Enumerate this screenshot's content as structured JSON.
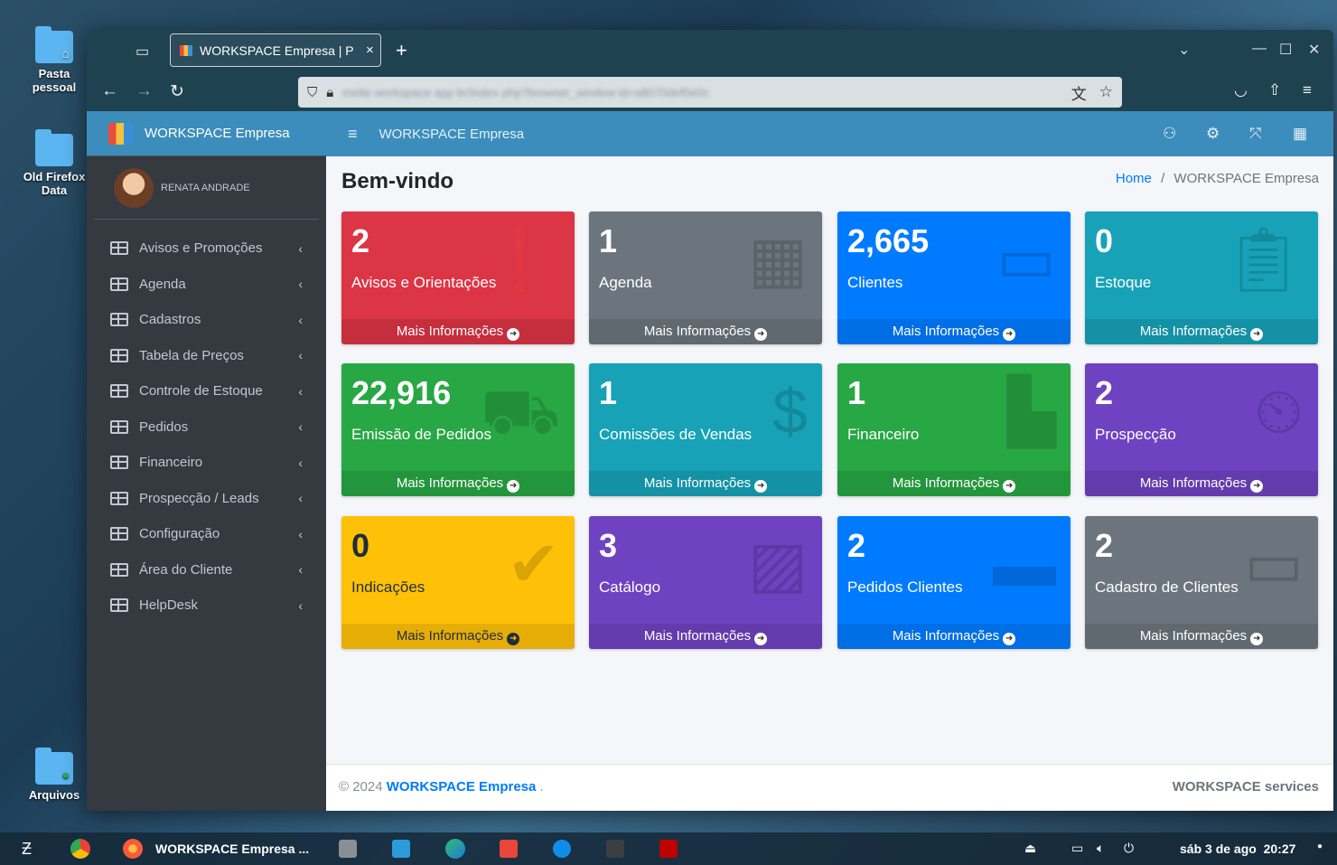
{
  "desktop": {
    "icons": [
      {
        "label": "Pasta pessoal"
      },
      {
        "label": "Old Firefox Data"
      },
      {
        "label": "Arquivos"
      }
    ]
  },
  "browser": {
    "tab_title": "WORKSPACE Empresa | P",
    "tab_close": "×",
    "new_tab": "+",
    "url": "meite workspace app br/index php?browser_window id=a8070def0e0c"
  },
  "app": {
    "brand": "WORKSPACE Empresa",
    "topbar_title": "WORKSPACE Empresa",
    "user_name": "RENATA ANDRADE",
    "menu": [
      {
        "label": "Avisos e Promoções"
      },
      {
        "label": "Agenda"
      },
      {
        "label": "Cadastros"
      },
      {
        "label": "Tabela de Preços"
      },
      {
        "label": "Controle de Estoque"
      },
      {
        "label": "Pedidos"
      },
      {
        "label": "Financeiro"
      },
      {
        "label": "Prospecção / Leads"
      },
      {
        "label": "Configuração"
      },
      {
        "label": "Área do Cliente"
      },
      {
        "label": "HelpDesk"
      }
    ],
    "heading": "Bem-vindo",
    "breadcrumb": {
      "home": "Home",
      "separator": "/",
      "current": "WORKSPACE Empresa"
    },
    "more_info": "Mais Informações",
    "boxes": [
      {
        "value": "2",
        "label": "Avisos e Orientações",
        "color": "#dc3545",
        "icon": "exclamation-icon"
      },
      {
        "value": "1",
        "label": "Agenda",
        "color": "#6c757d",
        "icon": "calendar-icon"
      },
      {
        "value": "2,665",
        "label": "Clientes",
        "color": "#007bff",
        "icon": "id-card-icon"
      },
      {
        "value": "0",
        "label": "Estoque",
        "color": "#17a2b8",
        "icon": "clipboard-icon"
      },
      {
        "value": "22,916",
        "label": "Emissão de Pedidos",
        "color": "#28a745",
        "icon": "dolly-icon"
      },
      {
        "value": "1",
        "label": "Comissões de Vendas",
        "color": "#17a2b8",
        "icon": "money-check-icon"
      },
      {
        "value": "1",
        "label": "Financeiro",
        "color": "#28a745",
        "icon": "chart-bar-icon"
      },
      {
        "value": "2",
        "label": "Prospecção",
        "color": "#6f42c1",
        "icon": "business-time-icon"
      },
      {
        "value": "0",
        "label": "Indicações",
        "color": "#ffc107",
        "icon": "user-check-icon"
      },
      {
        "value": "3",
        "label": "Catálogo",
        "color": "#6f42c1",
        "icon": "images-icon"
      },
      {
        "value": "2",
        "label": "Pedidos Clientes",
        "color": "#007bff",
        "icon": "dolly-flatbed-icon"
      },
      {
        "value": "2",
        "label": "Cadastro de Clientes",
        "color": "#6c757d",
        "icon": "address-card-icon"
      }
    ],
    "footer_copyright": "© 2024 ",
    "footer_brand": "WORKSPACE Empresa",
    "footer_dot": " .",
    "footer_right": "WORKSPACE services"
  },
  "taskbar": {
    "firefox_label": "WORKSPACE Empresa ...",
    "datetime": "sáb 3 de ago  20:27"
  }
}
